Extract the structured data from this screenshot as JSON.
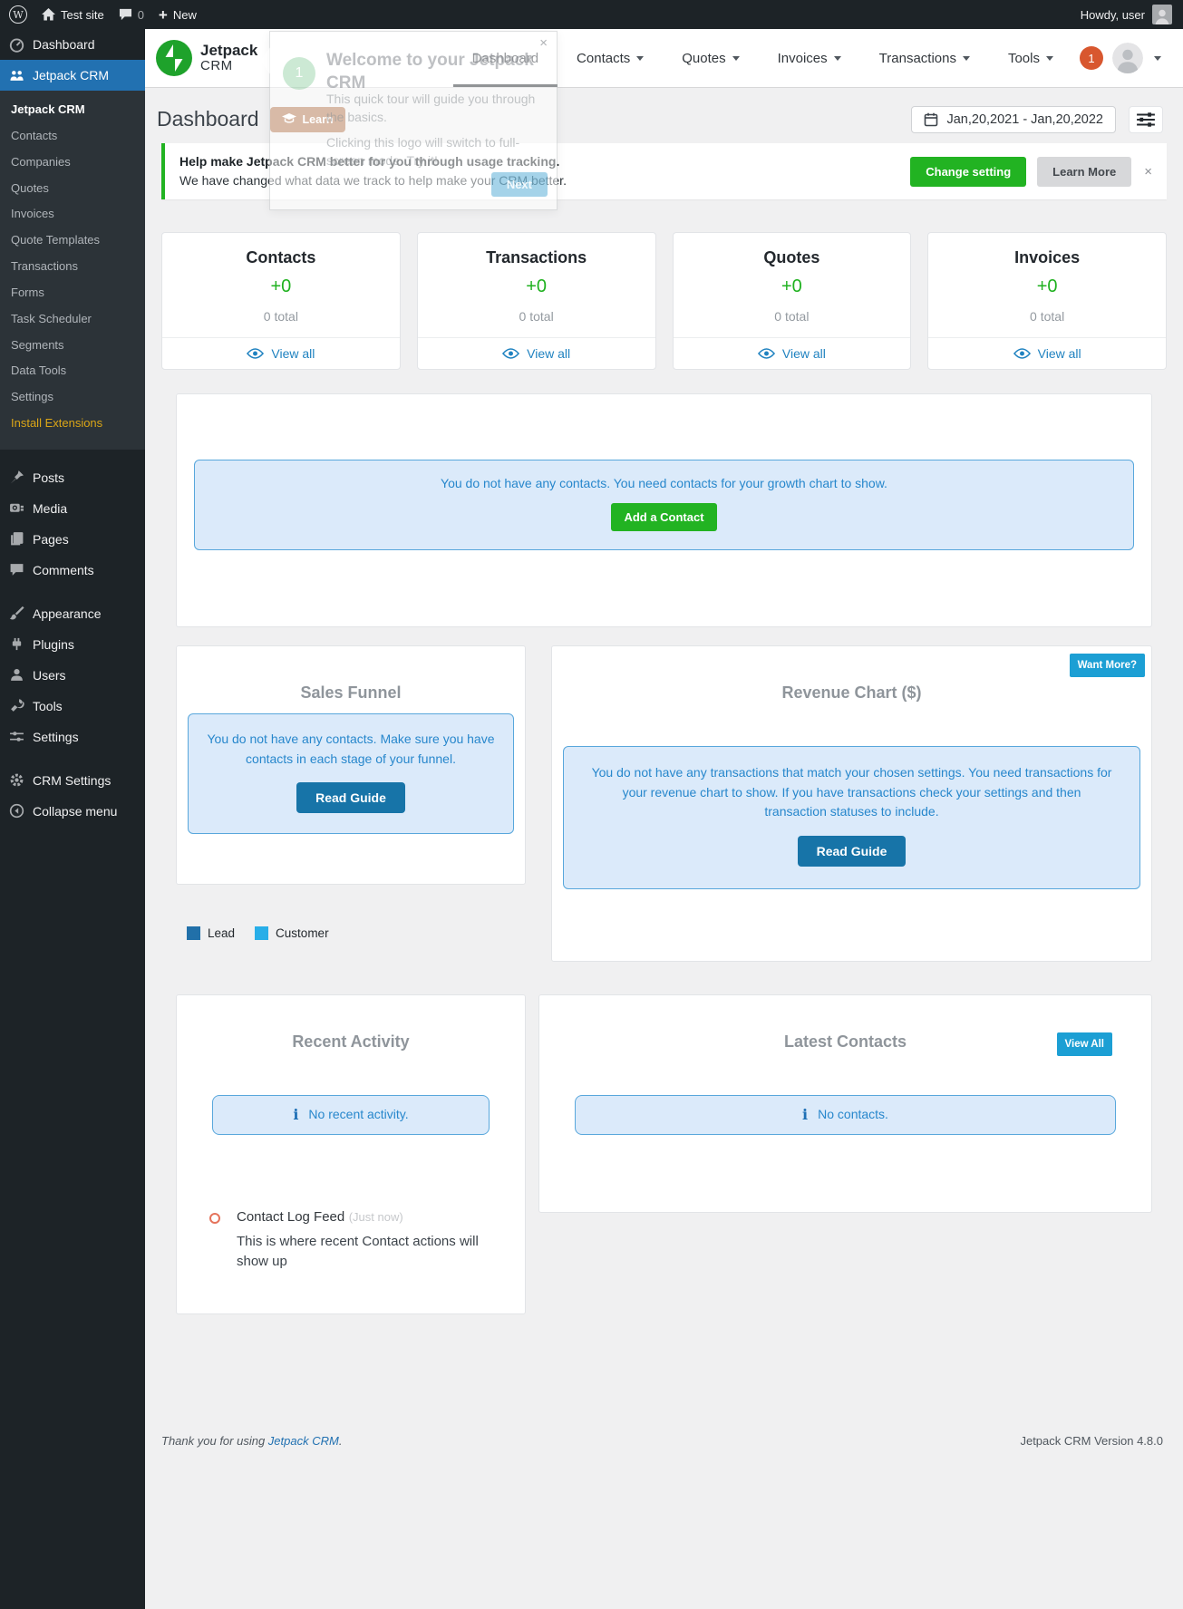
{
  "icons": {
    "wp_glyph": "W",
    "plus": "+",
    "close": "×",
    "info": "i"
  },
  "admin_bar": {
    "site_name": "Test site",
    "comment_count": "0",
    "new_label": "New",
    "howdy": "Howdy, user"
  },
  "sidebar": {
    "top": [
      {
        "label": "Dashboard"
      },
      {
        "label": "Jetpack CRM"
      }
    ],
    "submenu": [
      "Jetpack CRM",
      "Contacts",
      "Companies",
      "Quotes",
      "Invoices",
      "Quote Templates",
      "Transactions",
      "Forms",
      "Task Scheduler",
      "Segments",
      "Data Tools",
      "Settings",
      "Install Extensions"
    ],
    "group1": [
      "Posts",
      "Media",
      "Pages",
      "Comments"
    ],
    "group2": [
      "Appearance",
      "Plugins",
      "Users",
      "Tools",
      "Settings"
    ],
    "group3": [
      "CRM Settings",
      "Collapse menu"
    ]
  },
  "header": {
    "brand_line1": "Jetpack",
    "brand_line2": "CRM",
    "nav": [
      {
        "label": "Dashboard"
      },
      {
        "label": "Contacts"
      },
      {
        "label": "Quotes"
      },
      {
        "label": "Invoices"
      },
      {
        "label": "Transactions"
      },
      {
        "label": "Tools"
      }
    ],
    "badge": "1"
  },
  "tour_popup": {
    "step": "1",
    "title": "Welcome to your Jetpack CRM",
    "body1": "This quick tour will guide you through the basics.",
    "body2": "Clicking this logo will switch to full-screen mode. Try it!",
    "next_label": "Next"
  },
  "page": {
    "title": "Dashboard",
    "learn_label": "Learn",
    "date_range": "Jan,20,2021 - Jan,20,2022"
  },
  "notice": {
    "bold": "Help make Jetpack CRM better for you through usage tracking.",
    "text": "We have changed what data we track to help make your CRM better.",
    "change_label": "Change setting",
    "learn_more_label": "Learn More"
  },
  "stats": [
    {
      "title": "Contacts",
      "delta": "+0",
      "total": "0 total",
      "view": "View all"
    },
    {
      "title": "Transactions",
      "delta": "+0",
      "total": "0 total",
      "view": "View all"
    },
    {
      "title": "Quotes",
      "delta": "+0",
      "total": "0 total",
      "view": "View all"
    },
    {
      "title": "Invoices",
      "delta": "+0",
      "total": "0 total",
      "view": "View all"
    }
  ],
  "growth": {
    "message": "You do not have any contacts. You need contacts for your growth chart to show.",
    "button": "Add a Contact"
  },
  "funnel": {
    "title": "Sales Funnel",
    "message": "You do not have any contacts. Make sure you have contacts in each stage of your funnel.",
    "button": "Read Guide",
    "legend": [
      {
        "label": "Lead",
        "color": "#2170a9"
      },
      {
        "label": "Customer",
        "color": "#28aee8"
      }
    ]
  },
  "revenue": {
    "want_more": "Want More?",
    "title": "Revenue Chart ($)",
    "message": "You do not have any transactions that match your chosen settings. You need transactions for your revenue chart to show. If you have transactions check your settings and then transaction statuses to include.",
    "button": "Read Guide"
  },
  "activity": {
    "title": "Recent Activity",
    "empty": "No recent activity.",
    "log_title": "Contact Log Feed",
    "log_time": "(Just now)",
    "log_desc": "This is where recent Contact actions will show up"
  },
  "latest_contacts": {
    "title": "Latest Contacts",
    "view_all": "View All",
    "empty": "No contacts."
  },
  "footer": {
    "thanks_prefix": "Thank you for using ",
    "link": "Jetpack CRM",
    "suffix": ".",
    "version": "Jetpack CRM Version 4.8.0"
  },
  "colors": {
    "success_green": "#22b322",
    "info_blue_text": "#2787cc",
    "badge_blue": "#1c9fd4",
    "active_menu": "#2271b1"
  }
}
